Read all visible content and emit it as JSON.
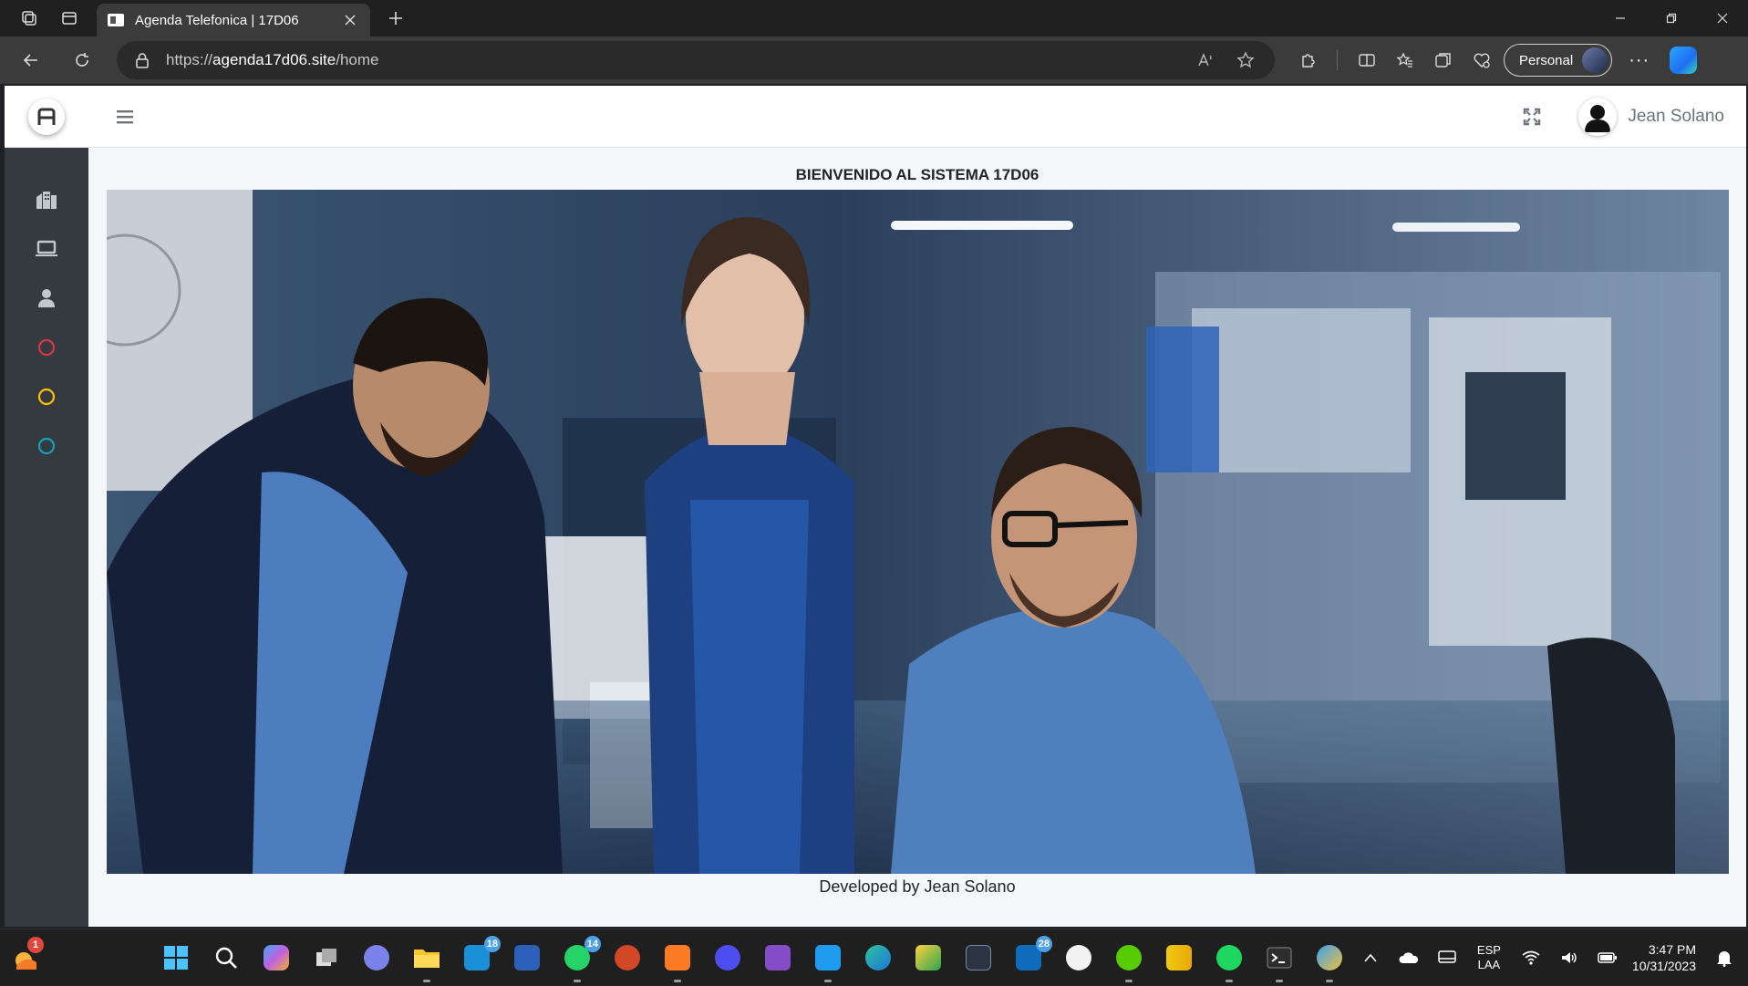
{
  "browser": {
    "tab_title": "Agenda Telefonica | 17D06",
    "url_scheme": "https://",
    "url_host": "agenda17d06.site",
    "url_path": "/home",
    "profile_label": "Personal"
  },
  "app": {
    "user_name": "Jean Solano",
    "welcome_heading": "BIENVENIDO AL SISTEMA 17D06",
    "footer_credit": "Developed by Jean Solano",
    "sidebar_items": [
      {
        "icon": "building-icon",
        "color": "#c2c7d0"
      },
      {
        "icon": "laptop-icon",
        "color": "#c2c7d0"
      },
      {
        "icon": "user-icon",
        "color": "#c2c7d0"
      },
      {
        "icon": "circle-icon",
        "color": "#dc3545"
      },
      {
        "icon": "circle-icon",
        "color": "#ffc107"
      },
      {
        "icon": "circle-icon",
        "color": "#17a2b8"
      }
    ],
    "hero_image": "office-team-photo"
  },
  "taskbar": {
    "weather_badge": "1",
    "badges": {
      "mail": "18",
      "whatsapp": "14",
      "outlook": "28"
    },
    "language_line1": "ESP",
    "language_line2": "LAA",
    "time": "3:47 PM",
    "date": "10/31/2023"
  }
}
